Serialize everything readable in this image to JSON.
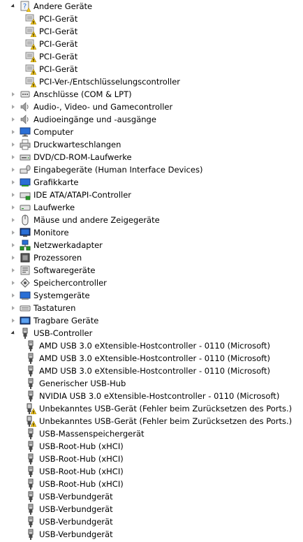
{
  "colors": {
    "warning": "#f0c419",
    "usb_plug": "#4a4a4a",
    "monitor_blue": "#2a6fd6"
  },
  "tree": [
    {
      "level": 0,
      "state": "expanded",
      "icon": "unknown-device-icon",
      "label": "Andere Geräte",
      "name": "category-andere-geraete"
    },
    {
      "level": 1,
      "state": "leaf",
      "icon": "warning-device-icon",
      "label": "PCI-Gerät",
      "name": "device-pci-1"
    },
    {
      "level": 1,
      "state": "leaf",
      "icon": "warning-device-icon",
      "label": "PCI-Gerät",
      "name": "device-pci-2"
    },
    {
      "level": 1,
      "state": "leaf",
      "icon": "warning-device-icon",
      "label": "PCI-Gerät",
      "name": "device-pci-3"
    },
    {
      "level": 1,
      "state": "leaf",
      "icon": "warning-device-icon",
      "label": "PCI-Gerät",
      "name": "device-pci-4"
    },
    {
      "level": 1,
      "state": "leaf",
      "icon": "warning-device-icon",
      "label": "PCI-Gerät",
      "name": "device-pci-5"
    },
    {
      "level": 1,
      "state": "leaf",
      "icon": "warning-device-icon",
      "label": "PCI-Ver-/Entschlüsselungscontroller",
      "name": "device-pci-crypto"
    },
    {
      "level": 0,
      "state": "collapsed",
      "icon": "port-icon",
      "label": "Anschlüsse (COM & LPT)",
      "name": "category-anschluesse"
    },
    {
      "level": 0,
      "state": "collapsed",
      "icon": "speaker-icon",
      "label": "Audio-, Video- und Gamecontroller",
      "name": "category-audio-video"
    },
    {
      "level": 0,
      "state": "collapsed",
      "icon": "speaker-icon",
      "label": "Audioeingänge und -ausgänge",
      "name": "category-audio-io"
    },
    {
      "level": 0,
      "state": "collapsed",
      "icon": "computer-icon",
      "label": "Computer",
      "name": "category-computer"
    },
    {
      "level": 0,
      "state": "collapsed",
      "icon": "printer-icon",
      "label": "Druckwarteschlangen",
      "name": "category-druck"
    },
    {
      "level": 0,
      "state": "collapsed",
      "icon": "dvd-drive-icon",
      "label": "DVD/CD-ROM-Laufwerke",
      "name": "category-dvd"
    },
    {
      "level": 0,
      "state": "collapsed",
      "icon": "hid-icon",
      "label": "Eingabegeräte (Human Interface Devices)",
      "name": "category-hid"
    },
    {
      "level": 0,
      "state": "collapsed",
      "icon": "display-adapter-icon",
      "label": "Grafikkarte",
      "name": "category-grafik"
    },
    {
      "level": 0,
      "state": "collapsed",
      "icon": "ide-controller-icon",
      "label": "IDE ATA/ATAPI-Controller",
      "name": "category-ide"
    },
    {
      "level": 0,
      "state": "collapsed",
      "icon": "drive-icon",
      "label": "Laufwerke",
      "name": "category-laufwerke"
    },
    {
      "level": 0,
      "state": "collapsed",
      "icon": "mouse-icon",
      "label": "Mäuse und andere Zeigegeräte",
      "name": "category-maeuse"
    },
    {
      "level": 0,
      "state": "collapsed",
      "icon": "monitor-icon",
      "label": "Monitore",
      "name": "category-monitore"
    },
    {
      "level": 0,
      "state": "collapsed",
      "icon": "network-icon",
      "label": "Netzwerkadapter",
      "name": "category-netzwerk"
    },
    {
      "level": 0,
      "state": "collapsed",
      "icon": "processor-icon",
      "label": "Prozessoren",
      "name": "category-prozessoren"
    },
    {
      "level": 0,
      "state": "collapsed",
      "icon": "software-device-icon",
      "label": "Softwaregeräte",
      "name": "category-software"
    },
    {
      "level": 0,
      "state": "collapsed",
      "icon": "storage-controller-icon",
      "label": "Speichercontroller",
      "name": "category-speicher"
    },
    {
      "level": 0,
      "state": "collapsed",
      "icon": "system-device-icon",
      "label": "Systemgeräte",
      "name": "category-system"
    },
    {
      "level": 0,
      "state": "collapsed",
      "icon": "keyboard-icon",
      "label": "Tastaturen",
      "name": "category-tastaturen"
    },
    {
      "level": 0,
      "state": "collapsed",
      "icon": "portable-device-icon",
      "label": "Tragbare Geräte",
      "name": "category-tragbar"
    },
    {
      "level": 0,
      "state": "expanded",
      "icon": "usb-icon",
      "label": "USB-Controller",
      "name": "category-usb"
    },
    {
      "level": 1,
      "state": "leaf",
      "icon": "usb-icon",
      "label": "AMD USB 3.0 eXtensible-Hostcontroller - 0110 (Microsoft)",
      "name": "device-usb-amd-1"
    },
    {
      "level": 1,
      "state": "leaf",
      "icon": "usb-icon",
      "label": "AMD USB 3.0 eXtensible-Hostcontroller - 0110 (Microsoft)",
      "name": "device-usb-amd-2"
    },
    {
      "level": 1,
      "state": "leaf",
      "icon": "usb-icon",
      "label": "AMD USB 3.0 eXtensible-Hostcontroller - 0110 (Microsoft)",
      "name": "device-usb-amd-3"
    },
    {
      "level": 1,
      "state": "leaf",
      "icon": "usb-icon",
      "label": "Generischer USB-Hub",
      "name": "device-usb-hub"
    },
    {
      "level": 1,
      "state": "leaf",
      "icon": "usb-icon",
      "label": "NVIDIA USB 3.0 eXtensible-Hostcontroller - 0110 (Microsoft)",
      "name": "device-usb-nvidia"
    },
    {
      "level": 1,
      "state": "leaf",
      "icon": "usb-warning-icon",
      "label": "Unbekanntes USB-Gerät (Fehler beim Zurücksetzen des Ports.)",
      "name": "device-usb-unknown-1"
    },
    {
      "level": 1,
      "state": "leaf",
      "icon": "usb-warning-icon",
      "label": "Unbekanntes USB-Gerät (Fehler beim Zurücksetzen des Ports.)",
      "name": "device-usb-unknown-2"
    },
    {
      "level": 1,
      "state": "leaf",
      "icon": "usb-icon",
      "label": "USB-Massenspeichergerät",
      "name": "device-usb-mass-storage"
    },
    {
      "level": 1,
      "state": "leaf",
      "icon": "usb-icon",
      "label": "USB-Root-Hub (xHCI)",
      "name": "device-usb-root-hub-1"
    },
    {
      "level": 1,
      "state": "leaf",
      "icon": "usb-icon",
      "label": "USB-Root-Hub (xHCI)",
      "name": "device-usb-root-hub-2"
    },
    {
      "level": 1,
      "state": "leaf",
      "icon": "usb-icon",
      "label": "USB-Root-Hub (xHCI)",
      "name": "device-usb-root-hub-3"
    },
    {
      "level": 1,
      "state": "leaf",
      "icon": "usb-icon",
      "label": "USB-Root-Hub (xHCI)",
      "name": "device-usb-root-hub-4"
    },
    {
      "level": 1,
      "state": "leaf",
      "icon": "usb-icon",
      "label": "USB-Verbundgerät",
      "name": "device-usb-composite-1"
    },
    {
      "level": 1,
      "state": "leaf",
      "icon": "usb-icon",
      "label": "USB-Verbundgerät",
      "name": "device-usb-composite-2"
    },
    {
      "level": 1,
      "state": "leaf",
      "icon": "usb-icon",
      "label": "USB-Verbundgerät",
      "name": "device-usb-composite-3"
    },
    {
      "level": 1,
      "state": "leaf",
      "icon": "usb-icon",
      "label": "USB-Verbundgerät",
      "name": "device-usb-composite-4"
    }
  ]
}
